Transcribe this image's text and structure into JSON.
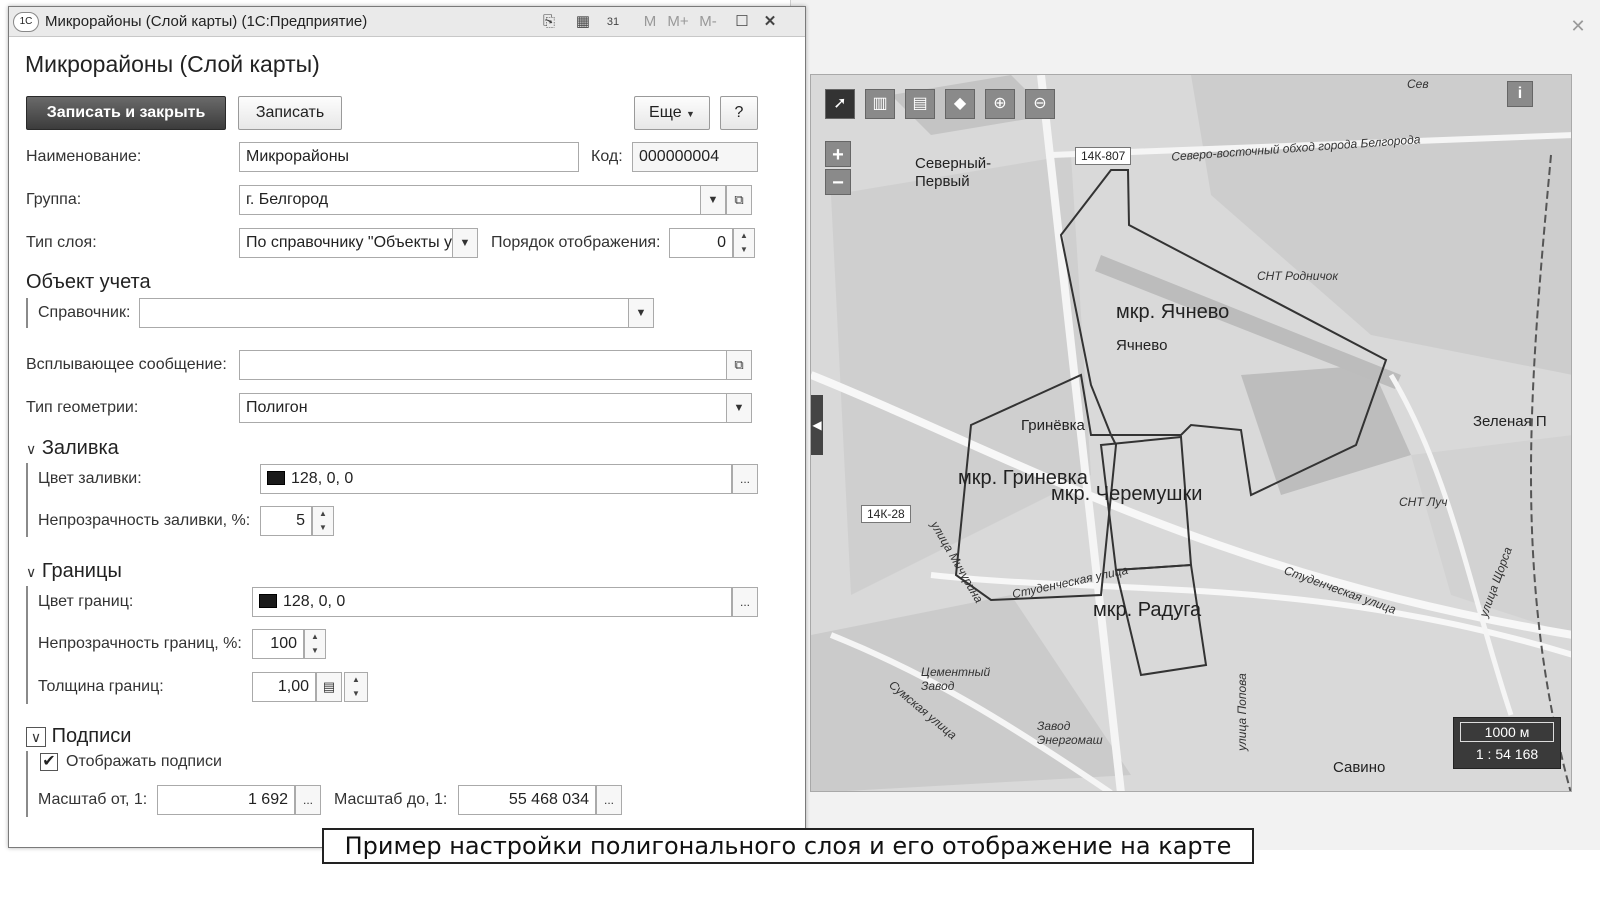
{
  "window": {
    "title": "Микрорайоны (Слой карты)  (1С:Предприятие)",
    "toolbar_icons": [
      "link-icon",
      "calendar-icon",
      "calendar-31-icon"
    ],
    "mem_buttons": [
      "M",
      "M+",
      "M-"
    ]
  },
  "form": {
    "heading": "Микрорайоны (Слой карты)",
    "buttons": {
      "save_close": "Записать и закрыть",
      "save": "Записать",
      "more": "Еще",
      "help": "?"
    },
    "name_label": "Наименование:",
    "name_value": "Микрорайоны",
    "code_label": "Код:",
    "code_value": "000000004",
    "group_label": "Группа:",
    "group_value": "г. Белгород",
    "layer_type_label": "Тип слоя:",
    "layer_type_value": "По справочнику \"Объекты у",
    "display_order_label": "Порядок отображения:",
    "display_order_value": "0",
    "accounting_object_title": "Объект учета",
    "catalog_label": "Справочник:",
    "catalog_value": "",
    "popup_label": "Всплывающее сообщение:",
    "popup_value": "",
    "geometry_label": "Тип геометрии:",
    "geometry_value": "Полигон",
    "fill": {
      "title": "Заливка",
      "color_label": "Цвет заливки:",
      "color_value": "128, 0, 0",
      "opacity_label": "Непрозрачность заливки, %:",
      "opacity_value": "5"
    },
    "borders": {
      "title": "Границы",
      "color_label": "Цвет границ:",
      "color_value": "128, 0, 0",
      "opacity_label": "Непрозрачность границ, %:",
      "opacity_value": "100",
      "width_label": "Толщина границ:",
      "width_value": "1,00"
    },
    "captions": {
      "title": "Подписи",
      "show_label": "Отображать подписи",
      "show_checked": true,
      "scale_from_label": "Масштаб от, 1:",
      "scale_from_value": "1 692",
      "scale_to_label": "Масштаб до, 1:",
      "scale_to_value": "55 468 034"
    }
  },
  "map": {
    "districts": [
      "мкр. Ячнево",
      "мкр. Гриневка",
      "мкр. Черемушки",
      "мкр. Радуга"
    ],
    "places": [
      "Северный-Первый",
      "Ячнево",
      "Гринёвка",
      "Зеленая П",
      "Савино"
    ],
    "small_labels": [
      "СНТ Родничок",
      "СНТ Луч",
      "Цементный Завод",
      "Завод Энергомаш",
      "Студенческая улица",
      "улица Мичурина",
      "Сумская улица",
      "улица Попова",
      "Северо-восточный обход города Белгорода",
      "Студенческая улица",
      "улица Щорса",
      "Сев"
    ],
    "road_badges": [
      "14К-807",
      "14К-28"
    ],
    "scale_distance": "1000 м",
    "scale_ratio": "1 : 54 168",
    "tools": [
      "cursor-icon",
      "measure-icon",
      "layers-icon",
      "pan-icon",
      "zoom-in-icon",
      "zoom-out-icon"
    ],
    "zoom_in": "+",
    "zoom_out": "−",
    "info": "i"
  },
  "caption": "Пример настройки полигонального слоя и его отображение на карте",
  "colors": {
    "primary_button": "#3c3c3c",
    "map_bg": "#dcdcdc"
  }
}
